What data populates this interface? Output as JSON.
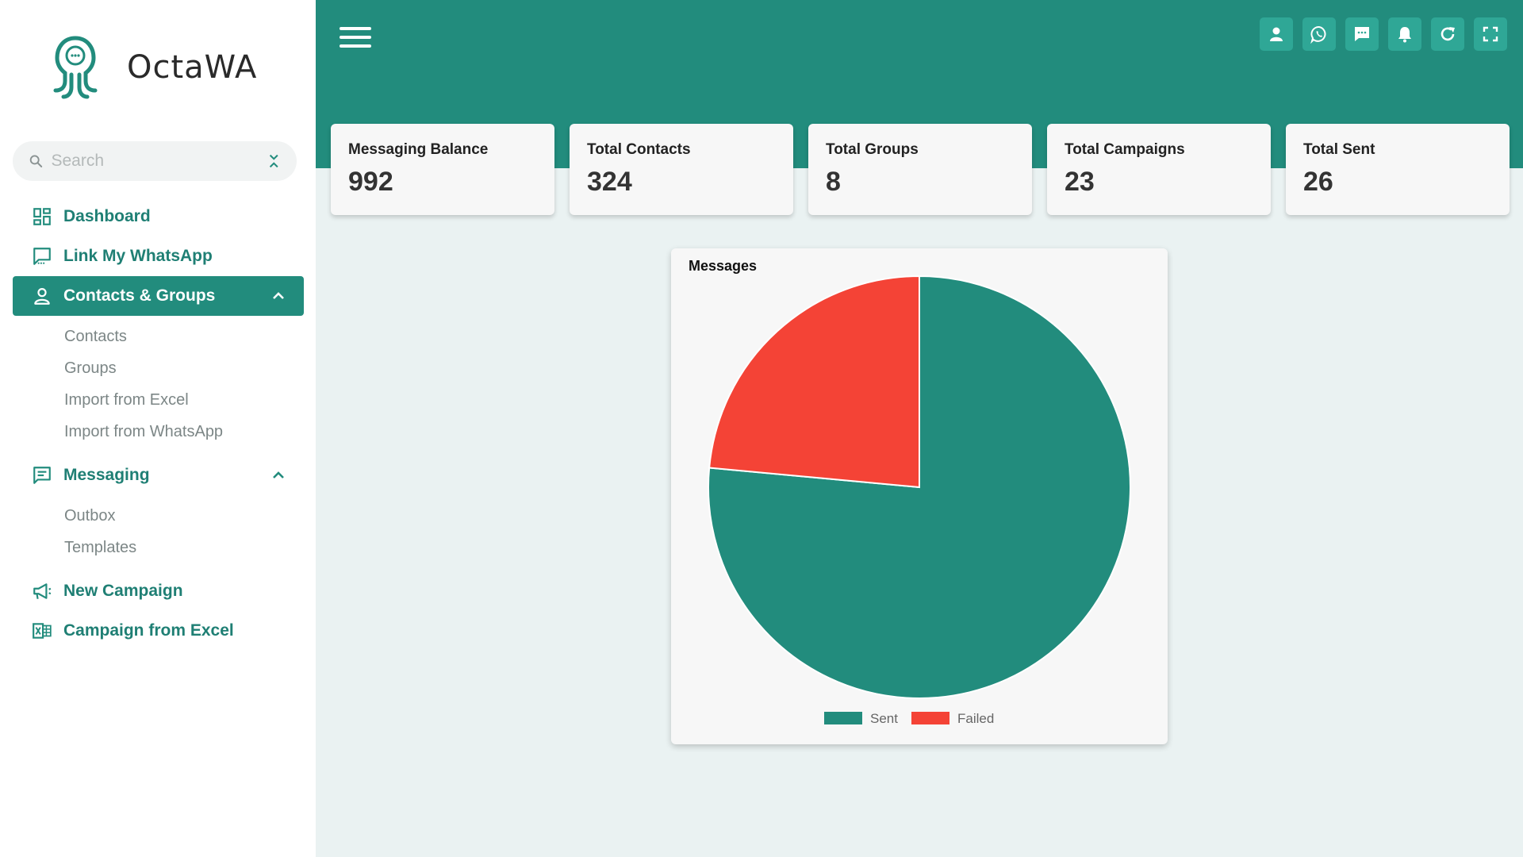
{
  "brand": {
    "name": "OctaWA"
  },
  "search": {
    "placeholder": "Search"
  },
  "sidebar": {
    "items": [
      {
        "label": "Dashboard",
        "icon": "dashboard-icon"
      },
      {
        "label": "Link My WhatsApp",
        "icon": "chat-icon"
      },
      {
        "label": "Contacts & Groups",
        "icon": "person-icon",
        "active": true,
        "children": [
          "Contacts",
          "Groups",
          "Import from Excel",
          "Import from WhatsApp"
        ]
      },
      {
        "label": "Messaging",
        "icon": "message-icon",
        "children": [
          "Outbox",
          "Templates"
        ]
      },
      {
        "label": "New Campaign",
        "icon": "megaphone-icon"
      },
      {
        "label": "Campaign from Excel",
        "icon": "excel-icon"
      }
    ]
  },
  "topbar": {
    "icons": [
      "user-icon",
      "whatsapp-icon",
      "chat-bubble-icon",
      "bell-icon",
      "refresh-icon",
      "fullscreen-icon"
    ]
  },
  "stats": [
    {
      "title": "Messaging Balance",
      "value": "992"
    },
    {
      "title": "Total Contacts",
      "value": "324"
    },
    {
      "title": "Total Groups",
      "value": "8"
    },
    {
      "title": "Total Campaigns",
      "value": "23"
    },
    {
      "title": "Total Sent",
      "value": "26"
    }
  ],
  "colors": {
    "primary": "#228c7d",
    "failed": "#f44336"
  },
  "chart_data": {
    "type": "pie",
    "title": "Messages",
    "categories": [
      "Sent",
      "Failed"
    ],
    "values": [
      26,
      8
    ],
    "colors": [
      "#228c7d",
      "#f44336"
    ],
    "legend": "bottom"
  }
}
